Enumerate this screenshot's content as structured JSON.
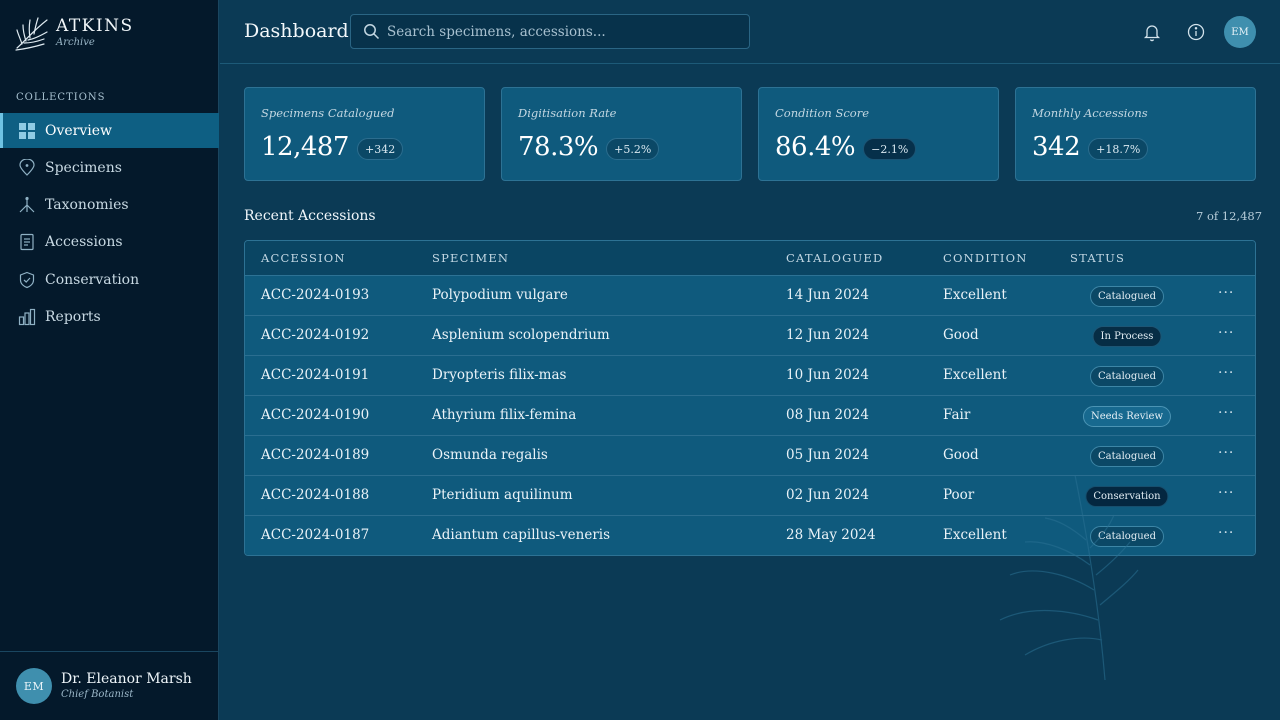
{
  "brand": {
    "name": "ATKINS",
    "subtitle": "Archive"
  },
  "sidebar": {
    "section_label": "COLLECTIONS",
    "items": [
      {
        "label": "Overview",
        "icon": "grid-icon",
        "active": true
      },
      {
        "label": "Specimens",
        "icon": "leaf-pin-icon",
        "active": false
      },
      {
        "label": "Taxonomies",
        "icon": "branch-icon",
        "active": false
      },
      {
        "label": "Accessions",
        "icon": "document-icon",
        "active": false
      },
      {
        "label": "Conservation",
        "icon": "shield-check-icon",
        "active": false
      },
      {
        "label": "Reports",
        "icon": "bar-chart-icon",
        "active": false
      }
    ]
  },
  "user": {
    "initials": "EM",
    "name": "Dr. Eleanor Marsh",
    "role": "Chief Botanist"
  },
  "header": {
    "title": "Dashboard",
    "search_placeholder": "Search specimens, accessions...",
    "avatar_initials": "EM"
  },
  "stats": [
    {
      "label": "Specimens Catalogued",
      "value": "12,487",
      "change": "+342"
    },
    {
      "label": "Digitisation Rate",
      "value": "78.3%",
      "change": "+5.2%"
    },
    {
      "label": "Condition Score",
      "value": "86.4%",
      "change": "−2.1%"
    },
    {
      "label": "Monthly Accessions",
      "value": "342",
      "change": "+18.7%"
    }
  ],
  "table": {
    "title": "Recent Accessions",
    "count": "7 of 12,487",
    "columns": [
      "ACCESSION",
      "SPECIMEN",
      "CATALOGUED",
      "CONDITION",
      "STATUS"
    ],
    "rows": [
      {
        "accession": "ACC-2024-0193",
        "specimen": "Polypodium vulgare",
        "date": "14 Jun 2024",
        "condition": "Excellent",
        "status": "Catalogued"
      },
      {
        "accession": "ACC-2024-0192",
        "specimen": "Asplenium scolopendrium",
        "date": "12 Jun 2024",
        "condition": "Good",
        "status": "In Process"
      },
      {
        "accession": "ACC-2024-0191",
        "specimen": "Dryopteris filix-mas",
        "date": "10 Jun 2024",
        "condition": "Excellent",
        "status": "Catalogued"
      },
      {
        "accession": "ACC-2024-0190",
        "specimen": "Athyrium filix-femina",
        "date": "08 Jun 2024",
        "condition": "Fair",
        "status": "Needs Review"
      },
      {
        "accession": "ACC-2024-0189",
        "specimen": "Osmunda regalis",
        "date": "05 Jun 2024",
        "condition": "Good",
        "status": "Catalogued"
      },
      {
        "accession": "ACC-2024-0188",
        "specimen": "Pteridium aquilinum",
        "date": "02 Jun 2024",
        "condition": "Poor",
        "status": "Conservation"
      },
      {
        "accession": "ACC-2024-0187",
        "specimen": "Adiantum capillus-veneris",
        "date": "28 May 2024",
        "condition": "Excellent",
        "status": "Catalogued"
      }
    ],
    "row_action": "···"
  },
  "colors": {
    "sidebar_bg": "#04192b",
    "main_bg": "#0b3a55",
    "card_bg": "#0f5a7d",
    "accent": "#6fc3e3"
  }
}
